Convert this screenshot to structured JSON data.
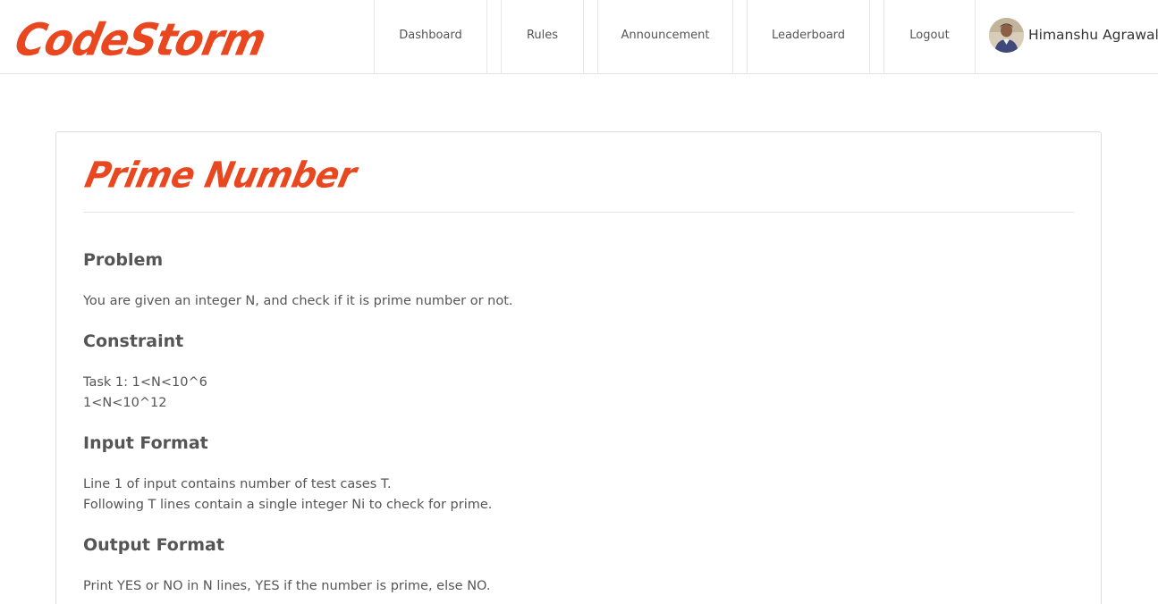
{
  "brand": {
    "name": "CodeStorm",
    "color": "#e8471f"
  },
  "nav": {
    "items": [
      {
        "label": "Dashboard"
      },
      {
        "label": "Rules"
      },
      {
        "label": "Announcement"
      },
      {
        "label": "Leaderboard"
      },
      {
        "label": "Logout"
      }
    ]
  },
  "user": {
    "name": "Himanshu Agrawal",
    "avatar": "user-avatar"
  },
  "problem": {
    "title": "Prime Number",
    "sections": [
      {
        "heading": "Problem",
        "lines": [
          "You are given an integer N, and check if it is prime number or not."
        ]
      },
      {
        "heading": "Constraint",
        "lines": [
          "Task 1: 1<N<10^6",
          "1<N<10^12"
        ]
      },
      {
        "heading": "Input Format",
        "lines": [
          "Line 1 of input contains number of test cases T.",
          "Following T lines contain a single integer Ni to check for prime."
        ]
      },
      {
        "heading": "Output Format",
        "lines": [
          "Print YES or NO in N lines, YES if the number is prime, else NO."
        ]
      }
    ]
  }
}
